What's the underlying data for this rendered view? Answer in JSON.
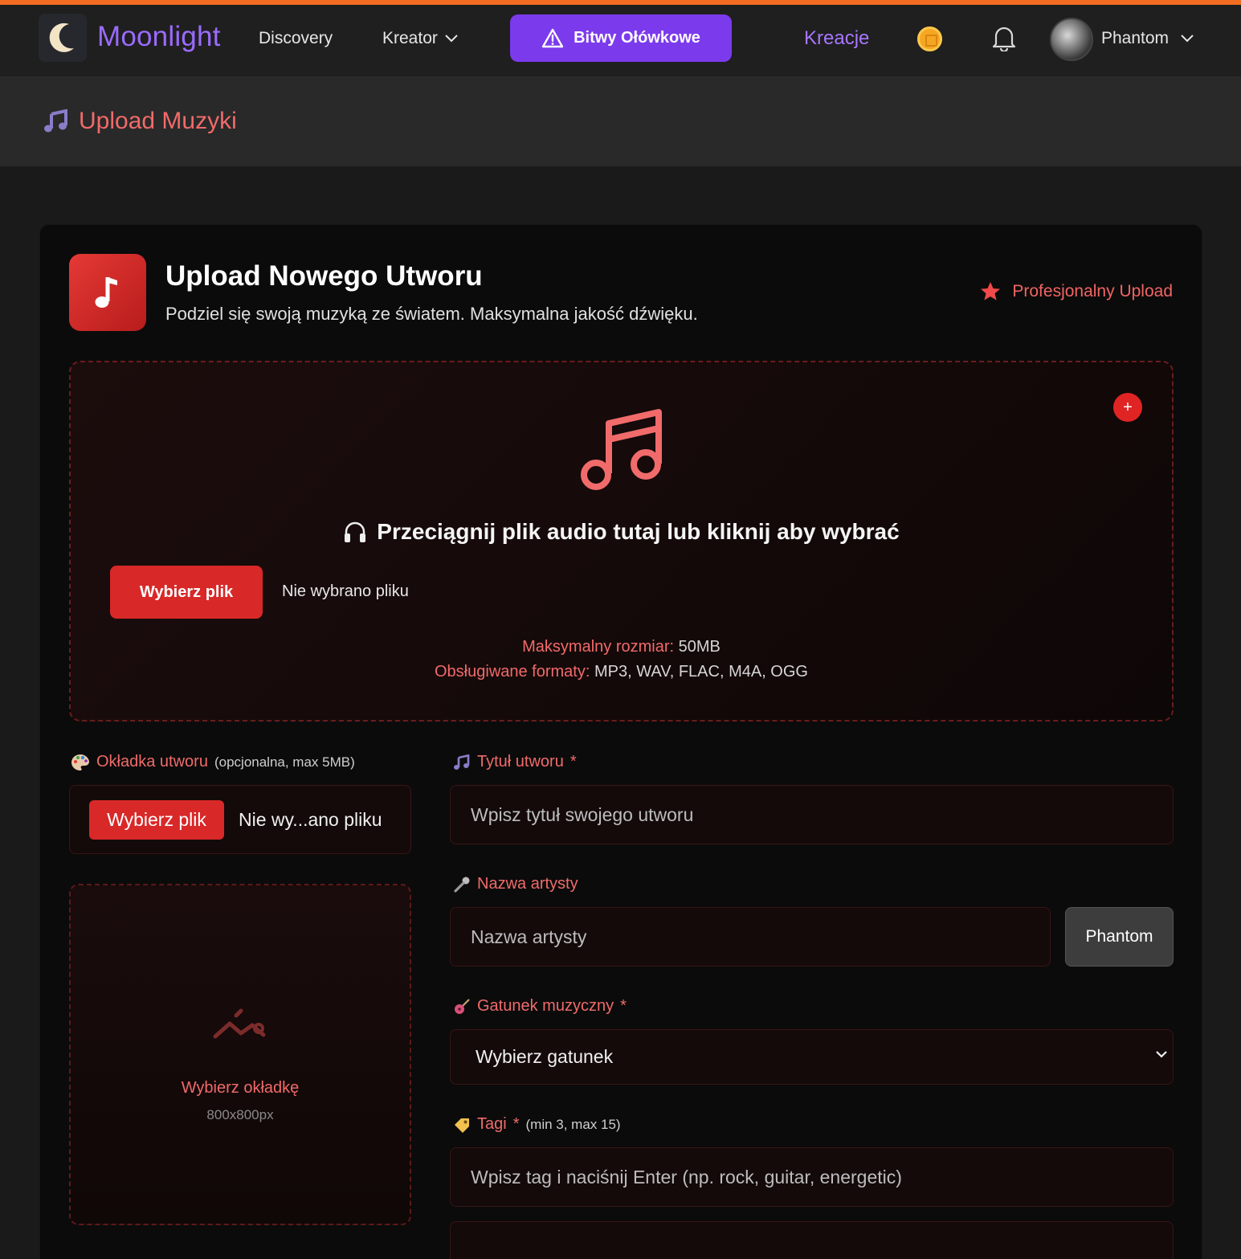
{
  "nav": {
    "logo": "Moonlight",
    "discovery": "Discovery",
    "kreator": "Kreator",
    "battles": "Bitwy Ołówkowe",
    "kreacje": "Kreacje",
    "user": "Phantom"
  },
  "page": {
    "title": "Upload Muzyki"
  },
  "card": {
    "title": "Upload Nowego Utworu",
    "subtitle": "Podziel się swoją muzyką ze światem. Maksymalna jakość dźwięku.",
    "badge": "Profesjonalny Upload"
  },
  "dropzone": {
    "plus": "+",
    "prompt": "Przeciągnij plik audio tutaj lub kliknij aby wybrać",
    "choose_button": "Wybierz plik",
    "no_file": "Nie wybrano pliku",
    "max_size_label": "Maksymalny rozmiar:",
    "max_size_value": "50MB",
    "formats_label": "Obsługiwane formaty:",
    "formats_value": "MP3, WAV, FLAC, M4A, OGG"
  },
  "cover": {
    "label": "Okładka utworu",
    "label_note": "(opcjonalna, max 5MB)",
    "choose_button": "Wybierz plik",
    "file_name": "Nie wy...ano pliku",
    "placeholder_title": "Wybierz okładkę",
    "placeholder_size": "800x800px"
  },
  "form": {
    "title_label": "Tytuł utworu",
    "required_mark": "*",
    "title_placeholder": "Wpisz tytuł swojego utworu",
    "artist_label": "Nazwa artysty",
    "artist_placeholder": "Nazwa artysty",
    "artist_fill_button": "Phantom",
    "genre_label": "Gatunek muzyczny",
    "genre_selected": "Wybierz gatunek",
    "tags_label": "Tagi",
    "tags_note": "(min 3, max 15)",
    "tags_placeholder": "Wpisz tag i naciśnij Enter (np. rock, guitar, energetic)"
  },
  "colors": {
    "accent_red": "#e02424",
    "accent_purple": "#7c3aed",
    "label_red": "#f16a6a",
    "top_bar": "#f26c21"
  }
}
